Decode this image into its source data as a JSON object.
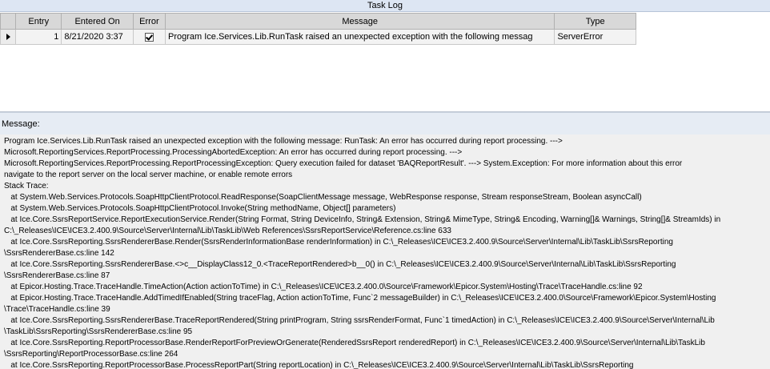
{
  "window": {
    "title": "Task Log"
  },
  "grid": {
    "columns": [
      "Entry",
      "Entered On",
      "Error",
      "Message",
      "Type"
    ],
    "rows": [
      {
        "entry": "1",
        "entered_on": "8/21/2020 3:37",
        "error": true,
        "message": "Program Ice.Services.Lib.RunTask raised an unexpected exception with the following messag",
        "type": "ServerError"
      }
    ]
  },
  "message_panel": {
    "label": "Message:",
    "text": "Program Ice.Services.Lib.RunTask raised an unexpected exception with the following message: RunTask: An error has occurred during report processing. --->\nMicrosoft.ReportingServices.ReportProcessing.ProcessingAbortedException: An error has occurred during report processing. --->\nMicrosoft.ReportingServices.ReportProcessing.ReportProcessingException: Query execution failed for dataset 'BAQReportResult'. ---> System.Exception: For more information about this error\nnavigate to the report server on the local server machine, or enable remote errors\nStack Trace:\n   at System.Web.Services.Protocols.SoapHttpClientProtocol.ReadResponse(SoapClientMessage message, WebResponse response, Stream responseStream, Boolean asyncCall)\n   at System.Web.Services.Protocols.SoapHttpClientProtocol.Invoke(String methodName, Object[] parameters)\n   at Ice.Core.SsrsReportService.ReportExecutionService.Render(String Format, String DeviceInfo, String& Extension, String& MimeType, String& Encoding, Warning[]& Warnings, String[]& StreamIds) in\nC:\\_Releases\\ICE\\ICE3.2.400.9\\Source\\Server\\Internal\\Lib\\TaskLib\\Web References\\SsrsReportService\\Reference.cs:line 633\n   at Ice.Core.SsrsReporting.SsrsRendererBase.Render(SsrsRenderInformationBase renderInformation) in C:\\_Releases\\ICE\\ICE3.2.400.9\\Source\\Server\\Internal\\Lib\\TaskLib\\SsrsReporting\n\\SsrsRendererBase.cs:line 142\n   at Ice.Core.SsrsReporting.SsrsRendererBase.<>c__DisplayClass12_0.<TraceReportRendered>b__0() in C:\\_Releases\\ICE\\ICE3.2.400.9\\Source\\Server\\Internal\\Lib\\TaskLib\\SsrsReporting\n\\SsrsRendererBase.cs:line 87\n   at Epicor.Hosting.Trace.TraceHandle.TimeAction(Action actionToTime) in C:\\_Releases\\ICE\\ICE3.2.400.0\\Source\\Framework\\Epicor.System\\Hosting\\Trace\\TraceHandle.cs:line 92\n   at Epicor.Hosting.Trace.TraceHandle.AddTimedIfEnabled(String traceFlag, Action actionToTime, Func`2 messageBuilder) in C:\\_Releases\\ICE\\ICE3.2.400.0\\Source\\Framework\\Epicor.System\\Hosting\n\\Trace\\TraceHandle.cs:line 39\n   at Ice.Core.SsrsReporting.SsrsRendererBase.TraceReportRendered(String printProgram, String ssrsRenderFormat, Func`1 timedAction) in C:\\_Releases\\ICE\\ICE3.2.400.9\\Source\\Server\\Internal\\Lib\n\\TaskLib\\SsrsReporting\\SsrsRendererBase.cs:line 95\n   at Ice.Core.SsrsReporting.ReportProcessorBase.RenderReportForPreviewOrGenerate(RenderedSsrsReport renderedReport) in C:\\_Releases\\ICE\\ICE3.2.400.9\\Source\\Server\\Internal\\Lib\\TaskLib\n\\SsrsReporting\\ReportProcessorBase.cs:line 264\n   at Ice.Core.SsrsReporting.ReportProcessorBase.ProcessReportPart(String reportLocation) in C:\\_Releases\\ICE\\ICE3.2.400.9\\Source\\Server\\Internal\\Lib\\TaskLib\\SsrsReporting"
  }
}
